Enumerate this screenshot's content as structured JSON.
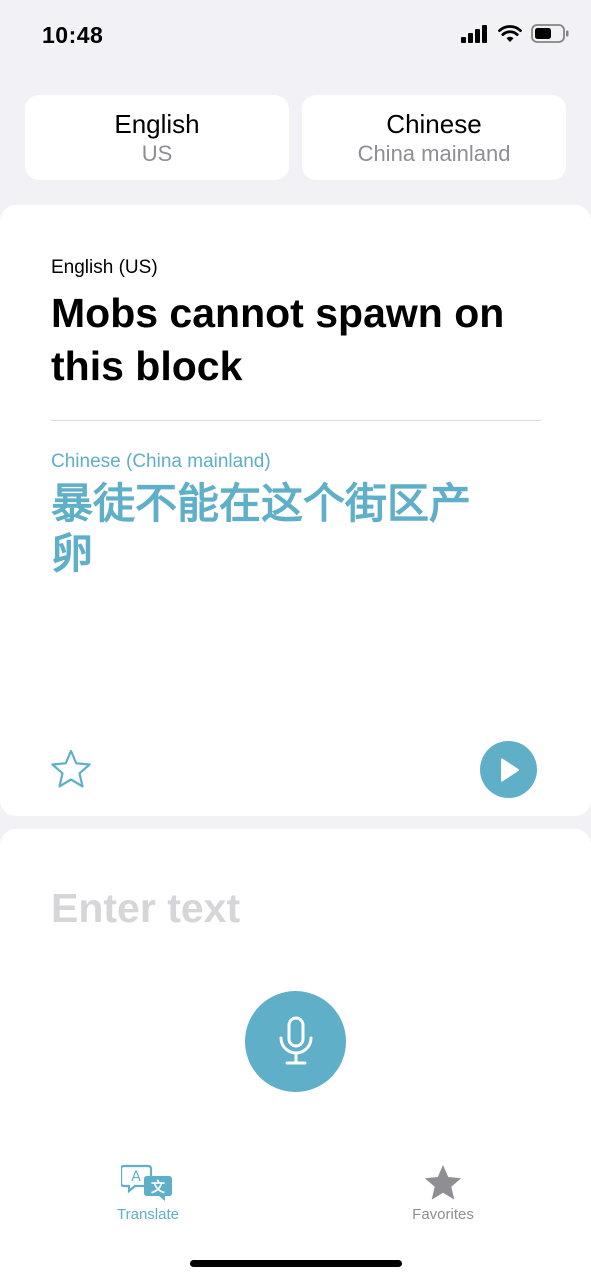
{
  "status_bar": {
    "time": "10:48"
  },
  "languages": {
    "source": {
      "name": "English",
      "region": "US"
    },
    "target": {
      "name": "Chinese",
      "region": "China mainland"
    }
  },
  "translation": {
    "source_label": "English (US)",
    "source_text": "Mobs cannot spawn on this block",
    "target_label": "Chinese (China mainland)",
    "target_text": "暴徒不能在这个街区产卵"
  },
  "input": {
    "placeholder": "Enter text",
    "value": ""
  },
  "tabs": [
    {
      "label": "Translate",
      "icon": "translate-icon",
      "active": true
    },
    {
      "label": "Favorites",
      "icon": "star-icon",
      "active": false
    }
  ],
  "colors": {
    "accent": "#5eafc7",
    "background": "#f1f1f6",
    "inactive": "#8e8e93"
  }
}
